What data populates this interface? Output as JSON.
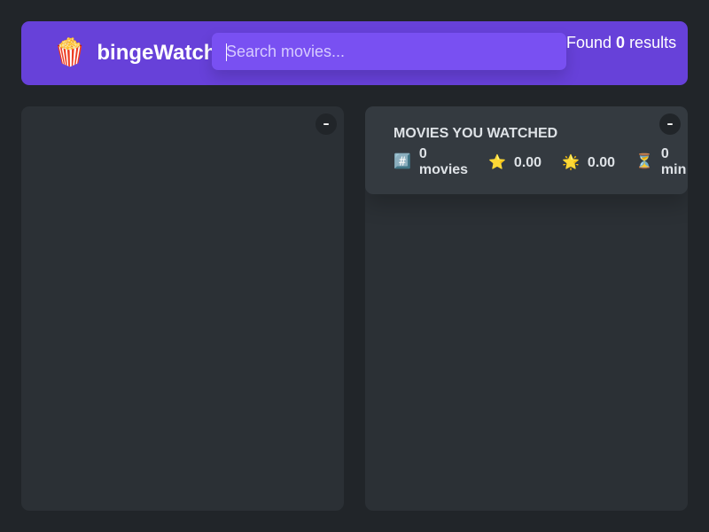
{
  "app": {
    "logo_icon": "🍿",
    "logo_text": "bingeWatch"
  },
  "search": {
    "placeholder": "Search movies...",
    "value": ""
  },
  "results": {
    "prefix": "Found ",
    "count": "0",
    "suffix": " results"
  },
  "left_box": {
    "toggle_label": "–"
  },
  "right_box": {
    "toggle_label": "–",
    "summary": {
      "title": "MOVIES YOU WATCHED",
      "stats": {
        "count": {
          "icon": "#️⃣",
          "value": "0",
          "unit": "movies"
        },
        "imdb_rating": {
          "icon": "⭐️",
          "value": "0.00"
        },
        "user_rating": {
          "icon": "🌟",
          "value": "0.00"
        },
        "runtime": {
          "icon": "⏳",
          "value": "0",
          "unit": "min"
        }
      }
    }
  },
  "colors": {
    "background": "#212529",
    "navbar": "#6741d9",
    "search": "#7950f2",
    "box": "#2b3035",
    "summary": "#343a40",
    "text": "#dee2e6"
  }
}
